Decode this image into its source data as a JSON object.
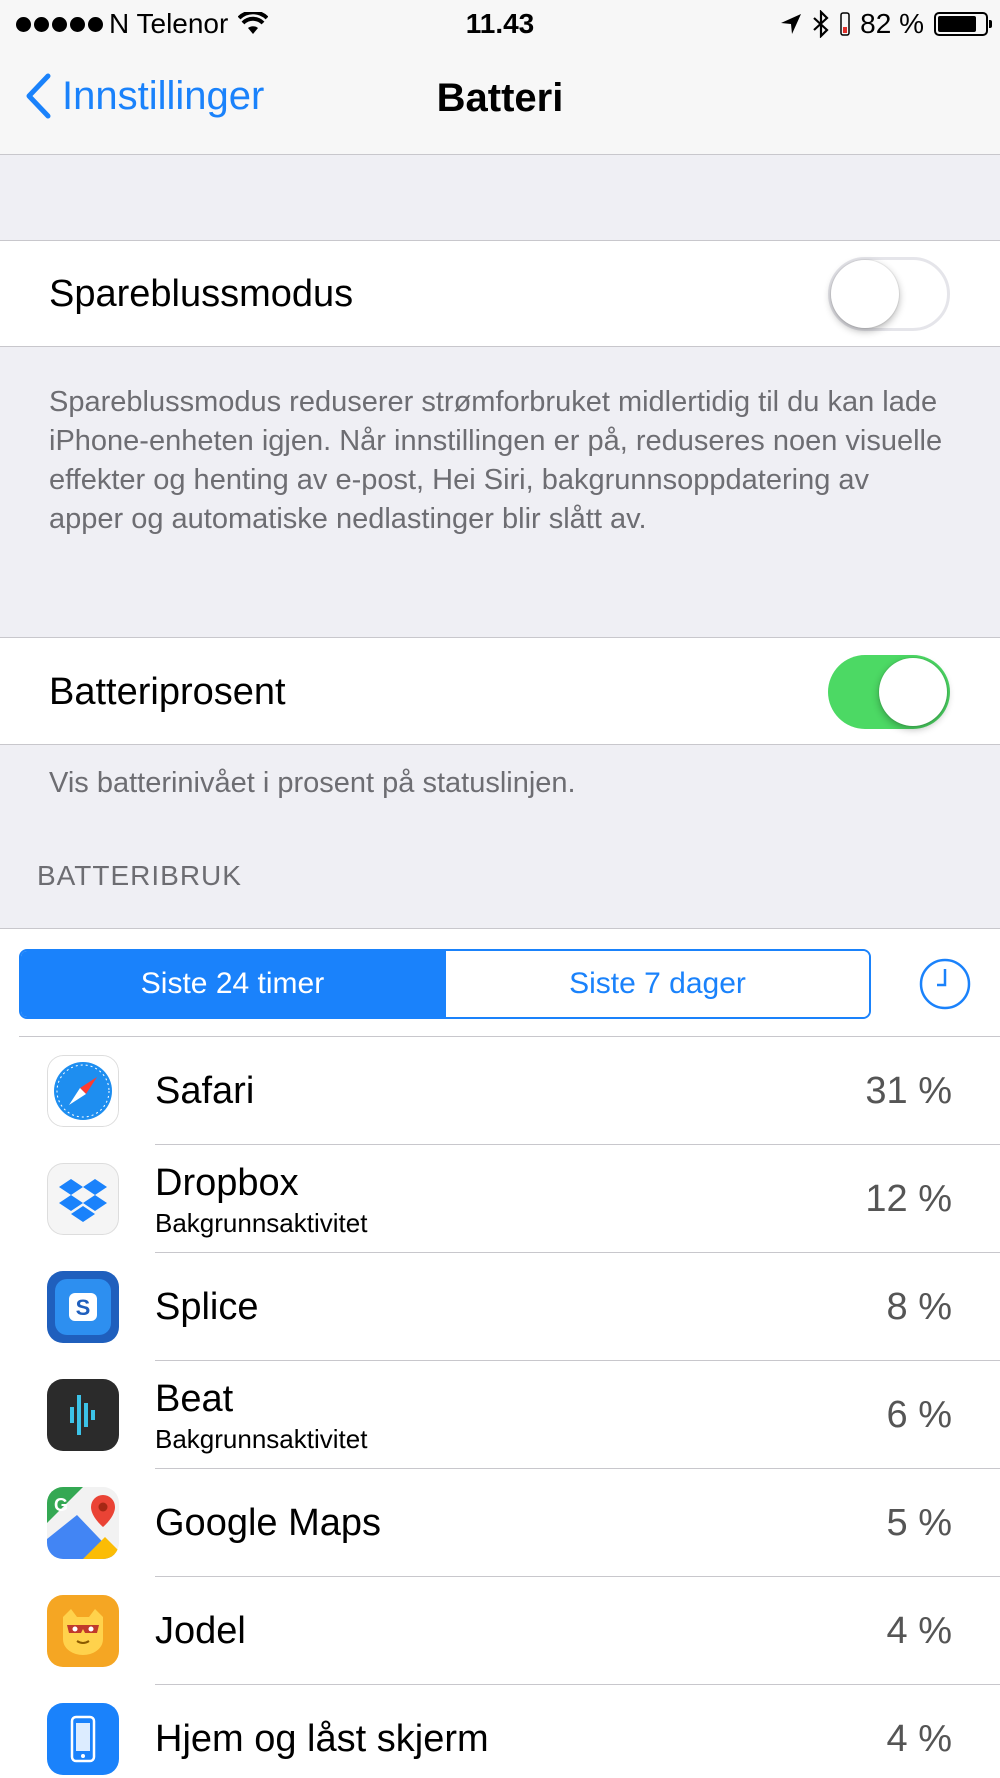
{
  "status_bar": {
    "carrier": "N Telenor",
    "time": "11.43",
    "battery_text": "82 %",
    "battery_level": 0.82,
    "icons": [
      "signal-dots-icon",
      "wifi-icon",
      "location-arrow-icon",
      "bluetooth-icon",
      "battery-icon"
    ]
  },
  "nav": {
    "back_label": "Innstillinger",
    "title": "Batteri"
  },
  "low_power": {
    "label": "Spareblussmodus",
    "enabled": false,
    "description": "Spareblussmodus reduserer strømforbruket midlertidig til du kan lade iPhone-enheten igjen. Når innstillingen er på, reduseres noen visuelle effekter og henting av e-post, Hei Siri, bakgrunnsoppdatering av apper og automatiske nedlastinger blir slått av."
  },
  "battery_percentage": {
    "label": "Batteriprosent",
    "enabled": true,
    "description": "Vis batterinivået i prosent på statuslinjen."
  },
  "usage": {
    "header": "BATTERIBRUK",
    "segments": [
      "Siste 24 timer",
      "Siste 7 dager"
    ],
    "selected_segment": 0,
    "apps": [
      {
        "name": "Safari",
        "subtitle": "",
        "percent": "31 %",
        "icon": "safari-icon"
      },
      {
        "name": "Dropbox",
        "subtitle": "Bakgrunnsaktivitet",
        "percent": "12 %",
        "icon": "dropbox-icon"
      },
      {
        "name": "Splice",
        "subtitle": "",
        "percent": "8 %",
        "icon": "splice-icon"
      },
      {
        "name": "Beat",
        "subtitle": "Bakgrunnsaktivitet",
        "percent": "6 %",
        "icon": "beat-icon"
      },
      {
        "name": "Google Maps",
        "subtitle": "",
        "percent": "5 %",
        "icon": "google-maps-icon"
      },
      {
        "name": "Jodel",
        "subtitle": "",
        "percent": "4 %",
        "icon": "jodel-icon"
      },
      {
        "name": "Hjem og låst skjerm",
        "subtitle": "",
        "percent": "4 %",
        "icon": "home-lock-screen-icon"
      }
    ]
  },
  "colors": {
    "accent": "#1a82fb",
    "toggle_on": "#4cd964",
    "group_background": "#efeff4",
    "footer_text": "#6d6d72"
  }
}
